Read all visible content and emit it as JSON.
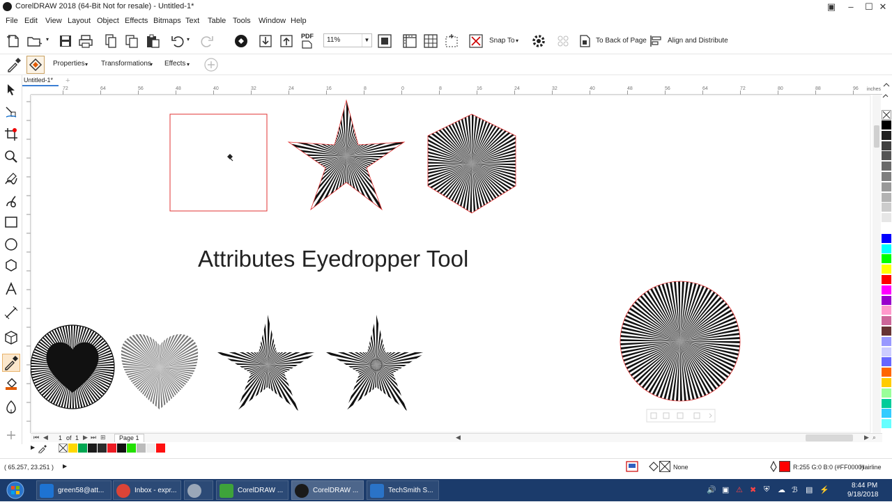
{
  "window": {
    "title": "CorelDRAW 2018 (64-Bit Not for resale) - Untitled-1*"
  },
  "menu": [
    "File",
    "Edit",
    "View",
    "Layout",
    "Object",
    "Effects",
    "Bitmaps",
    "Text",
    "Table",
    "Tools",
    "Window",
    "Help"
  ],
  "toolbar": {
    "zoom": "11%",
    "snap_to": "Snap To",
    "to_back": "To Back of Page",
    "align": "Align and Distribute",
    "pdf_label": "PDF"
  },
  "propbar": {
    "properties": "Properties",
    "transformations": "Transformations",
    "effects": "Effects"
  },
  "doc_tab": "Untitled-1*",
  "ruler": {
    "top_ticks": [
      "72",
      "64",
      "56",
      "48",
      "40",
      "32",
      "24",
      "16",
      "8",
      "0",
      "8",
      "16",
      "24",
      "32",
      "40",
      "48",
      "56",
      "64",
      "72",
      "80",
      "88",
      "96"
    ],
    "unit": "inches"
  },
  "canvas": {
    "heading": "Attributes Eyedropper Tool"
  },
  "pagebar": {
    "page_num": "1",
    "of_label": "of",
    "page_total": "1",
    "page_tab": "Page 1"
  },
  "doc_palette": [
    "#ffd800",
    "#00a651",
    "#1a1a1a",
    "#2b2b2b",
    "#ed1c24",
    "#111111",
    "#22e000",
    "#bbbbbb",
    "#eeeeee",
    "#ff1010"
  ],
  "palette": [
    "#000000",
    "#202020",
    "#404040",
    "#555555",
    "#6a6a6a",
    "#7f7f7f",
    "#999999",
    "#b3b3b3",
    "#cccccc",
    "#e6e6e6",
    "#ffffff",
    "#0000ff",
    "#00ffff",
    "#00ff00",
    "#ffff00",
    "#ff0000",
    "#ff00ff",
    "#9900cc",
    "#ff99cc",
    "#cc6699",
    "#663333",
    "#9999ff",
    "#ccccff",
    "#6666ff",
    "#ff6600",
    "#ffcc00",
    "#99ff99",
    "#00cc99",
    "#33ccff",
    "#66ffff"
  ],
  "status": {
    "coords": "( 65.257, 23.251 )",
    "fill": "None",
    "outline_color": "#ff0000",
    "outline_text": "R:255 G:0 B:0 (#FF0000)",
    "outline_width": "Hairline"
  },
  "taskbar": {
    "items": [
      {
        "label": "green58@att...",
        "color": "#1e73d2"
      },
      {
        "label": "Inbox - expr...",
        "color": "#db4437"
      },
      {
        "label": "",
        "color": "#9aa7b8"
      },
      {
        "label": "CorelDRAW ...",
        "color": "#3ea33a"
      },
      {
        "label": "CorelDRAW ...",
        "color": "#1a1a1a"
      },
      {
        "label": "TechSmith S...",
        "color": "#2a73c7"
      }
    ],
    "time": "8:44 PM",
    "date": "9/18/2018"
  }
}
